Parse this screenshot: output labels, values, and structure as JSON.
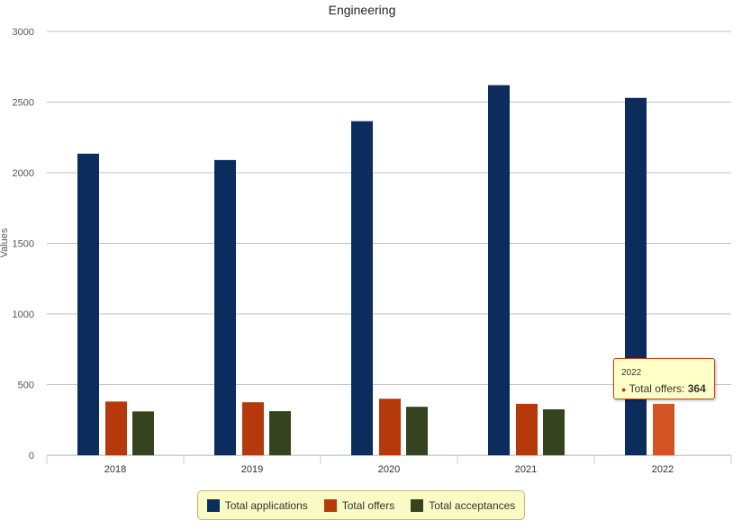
{
  "chart_data": {
    "type": "bar",
    "title": "Engineering",
    "ylabel": "Values",
    "xlabel": "",
    "ylim": [
      0,
      3000
    ],
    "yticks": [
      "0",
      "500",
      "1000",
      "1500",
      "2000",
      "2500",
      "3000"
    ],
    "categories": [
      "2018",
      "2019",
      "2020",
      "2021",
      "2022"
    ],
    "grid": true,
    "legend_placement": "bottom",
    "series": [
      {
        "name": "Total applications",
        "color": "#0b2c5c",
        "values": [
          2135,
          2090,
          2365,
          2620,
          2530
        ]
      },
      {
        "name": "Total offers",
        "color": "#b5390a",
        "values": [
          380,
          375,
          400,
          364,
          364
        ]
      },
      {
        "name": "Total acceptances",
        "color": "#36431f",
        "values": [
          310,
          312,
          343,
          325,
          null
        ]
      }
    ],
    "tooltip": {
      "category": "2022",
      "series": "Total offers",
      "label": "Total offers: ",
      "value": "364",
      "hover_color": "#d35422"
    }
  }
}
